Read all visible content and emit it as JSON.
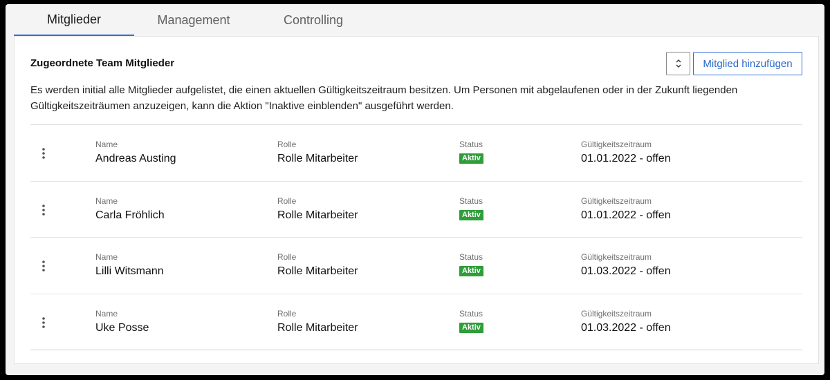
{
  "tabs": [
    {
      "label": "Mitglieder",
      "active": true
    },
    {
      "label": "Management",
      "active": false
    },
    {
      "label": "Controlling",
      "active": false
    }
  ],
  "section": {
    "title": "Zugeordnete Team Mitglieder",
    "sort_icon": "sort-updown-icon",
    "add_button_label": "Mitglied hinzufügen",
    "intro_line1": "Es werden initial alle Mitglieder aufgelistet, die einen aktuellen Gültigkeitszeitraum besitzen. Um Personen mit abgelaufenen oder in der Zukunft liegenden",
    "intro_line2": "Gültigkeitszeiträumen anzuzeigen, kann die Aktion \"Inaktive einblenden\" ausgeführt werden."
  },
  "columns": {
    "name": "Name",
    "role": "Rolle",
    "status": "Status",
    "period": "Gültigkeitszeitraum"
  },
  "members": [
    {
      "name": "Andreas Austing",
      "role": "Rolle Mitarbeiter",
      "status": "Aktiv",
      "period": "01.01.2022 - offen"
    },
    {
      "name": "Carla Fröhlich",
      "role": "Rolle Mitarbeiter",
      "status": "Aktiv",
      "period": "01.01.2022 - offen"
    },
    {
      "name": "Lilli Witsmann",
      "role": "Rolle Mitarbeiter",
      "status": "Aktiv",
      "period": "01.03.2022 - offen"
    },
    {
      "name": "Uke Posse",
      "role": "Rolle Mitarbeiter",
      "status": "Aktiv",
      "period": "01.03.2022 - offen"
    }
  ],
  "colors": {
    "accent": "#2f6fd6",
    "status_active": "#2f9e3a"
  }
}
